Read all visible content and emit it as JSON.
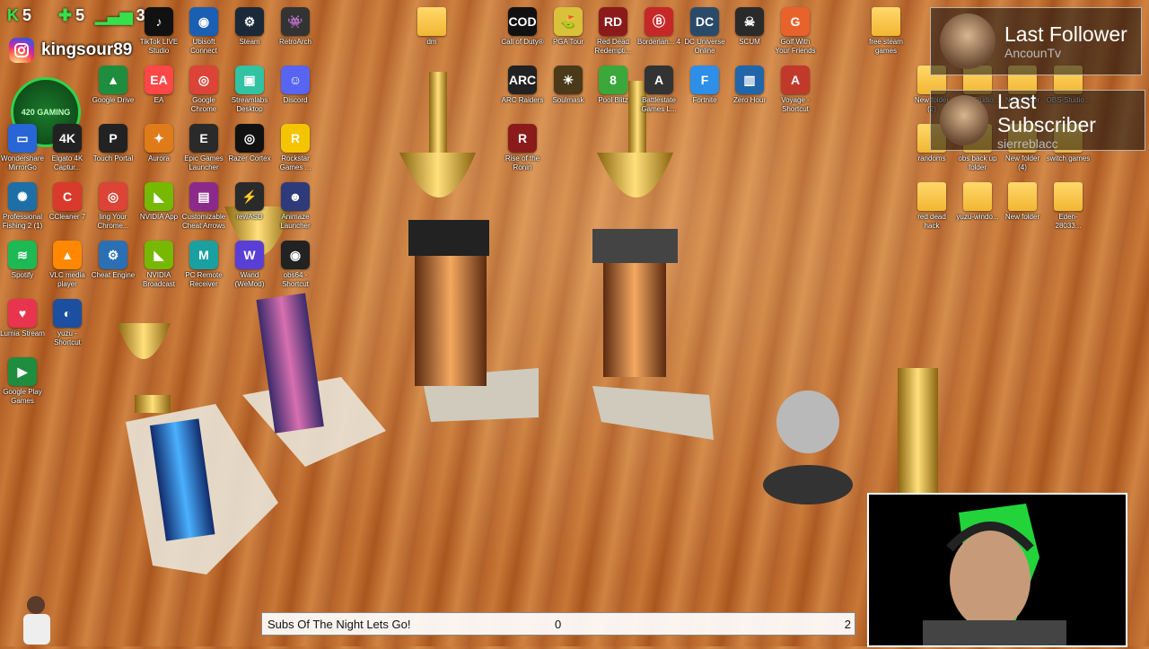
{
  "stats": {
    "kicks": "5",
    "follows": "5",
    "viewers": "3"
  },
  "instagram": {
    "handle": "kingsour89"
  },
  "badge": {
    "text": "420 GAMING"
  },
  "desktop_icons": [
    {
      "label": "TikTok LIVE Studio",
      "icon": "tiktok-icon",
      "color": "#111111",
      "glyph": "♪"
    },
    {
      "label": "Ubisoft Connect",
      "icon": "ubisoft-icon",
      "color": "#1a5fb4",
      "glyph": "◉"
    },
    {
      "label": "Steam",
      "icon": "steam-icon",
      "color": "#1b2838",
      "glyph": "⚙"
    },
    {
      "label": "RetroArch",
      "icon": "retroarch-icon",
      "color": "#333333",
      "glyph": "👾"
    },
    {
      "label": "Google Drive",
      "icon": "google-drive-icon",
      "color": "#1e8e3e",
      "glyph": "▲"
    },
    {
      "label": "EA",
      "icon": "ea-icon",
      "color": "#ff4747",
      "glyph": "EA"
    },
    {
      "label": "Google Chrome",
      "icon": "chrome-icon",
      "color": "#db4437",
      "glyph": "◎"
    },
    {
      "label": "Streamlabs Desktop",
      "icon": "streamlabs-icon",
      "color": "#31c3a2",
      "glyph": "▣"
    },
    {
      "label": "Discord",
      "icon": "discord-icon",
      "color": "#5865f2",
      "glyph": "☺"
    },
    {
      "label": "Wondershare MirrorGo",
      "icon": "mirrorgo-icon",
      "color": "#2866d8",
      "glyph": "▭"
    },
    {
      "label": "Elgato 4K Captur...",
      "icon": "elgato-icon",
      "color": "#222222",
      "glyph": "4K"
    },
    {
      "label": "Touch Portal",
      "icon": "touch-portal-icon",
      "color": "#222222",
      "glyph": "P"
    },
    {
      "label": "Aurora",
      "icon": "aurora-icon",
      "color": "#e07b1a",
      "glyph": "✦"
    },
    {
      "label": "Epic Games Launcher",
      "icon": "epic-games-icon",
      "color": "#2a2a2a",
      "glyph": "E"
    },
    {
      "label": "Razer Cortex",
      "icon": "razer-icon",
      "color": "#111111",
      "glyph": "◎"
    },
    {
      "label": "Rockstar Games ...",
      "icon": "rockstar-icon",
      "color": "#f5c400",
      "glyph": "R"
    },
    {
      "label": "Professional Fishing 2 (1)",
      "icon": "fishing-icon",
      "color": "#1d6fa5",
      "glyph": "✺"
    },
    {
      "label": "CCleaner 7",
      "icon": "ccleaner-icon",
      "color": "#d83b2b",
      "glyph": "C"
    },
    {
      "label": "ling Your Chrome...",
      "icon": "chrome-icon",
      "color": "#db4437",
      "glyph": "◎"
    },
    {
      "label": "NVIDIA App",
      "icon": "nvidia-icon",
      "color": "#76b900",
      "glyph": "◣"
    },
    {
      "label": "Customizable Cheat Arrows",
      "icon": "winrar-icon",
      "color": "#8b2a8b",
      "glyph": "▤"
    },
    {
      "label": "rewASD",
      "icon": "rewasd-icon",
      "color": "#2a2a2a",
      "glyph": "⚡"
    },
    {
      "label": "Animaze Launcher",
      "icon": "animaze-icon",
      "color": "#2f3a7a",
      "glyph": "☻"
    },
    {
      "label": "Spotify",
      "icon": "spotify-icon",
      "color": "#1db954",
      "glyph": "≋"
    },
    {
      "label": "VLC media player",
      "icon": "vlc-icon",
      "color": "#ff8800",
      "glyph": "▲"
    },
    {
      "label": "Cheat Engine",
      "icon": "cheat-engine-icon",
      "color": "#2b6fb5",
      "glyph": "⚙"
    },
    {
      "label": "NVIDIA Broadcast",
      "icon": "nvidia-broadcast-icon",
      "color": "#76b900",
      "glyph": "◣"
    },
    {
      "label": "PC Remote Receiver",
      "icon": "pc-remote-icon",
      "color": "#1aa0a0",
      "glyph": "M"
    },
    {
      "label": "Wand (WeMod)",
      "icon": "wand-icon",
      "color": "#5a3fd6",
      "glyph": "W"
    },
    {
      "label": "obs64 - Shortcut",
      "icon": "obs-icon",
      "color": "#222222",
      "glyph": "◉"
    },
    {
      "label": "Lumia Stream",
      "icon": "lumia-icon",
      "color": "#e8344e",
      "glyph": "♥"
    },
    {
      "label": "yuzu - Shortcut",
      "icon": "yuzu-icon",
      "color": "#1d4fa0",
      "glyph": "◐"
    },
    {
      "label": "Google Play Games",
      "icon": "play-games-icon",
      "color": "#1e8e3e",
      "glyph": "▶"
    },
    {
      "label": "dm",
      "icon": "folder-icon",
      "color": "#f2b632",
      "glyph": ""
    },
    {
      "label": "Call of Duty®",
      "icon": "cod-icon",
      "color": "#111111",
      "glyph": "COD"
    },
    {
      "label": "PGA Tour",
      "icon": "pga-icon",
      "color": "#d9c23a",
      "glyph": "⛳"
    },
    {
      "label": "Red Dead Redempti...",
      "icon": "rdr-icon",
      "color": "#8b1a1a",
      "glyph": "RD"
    },
    {
      "label": "Borderlan... 4",
      "icon": "borderlands-icon",
      "color": "#c62828",
      "glyph": "Ⓑ"
    },
    {
      "label": "DC Universe Online",
      "icon": "dcuo-icon",
      "color": "#2a4a6a",
      "glyph": "DC"
    },
    {
      "label": "SCUM",
      "icon": "scum-icon",
      "color": "#2a2a2a",
      "glyph": "☠"
    },
    {
      "label": "Golf With Your Friends",
      "icon": "golf-icon",
      "color": "#e8622b",
      "glyph": "G"
    },
    {
      "label": "ARC Raiders",
      "icon": "arc-raiders-icon",
      "color": "#222222",
      "glyph": "ARC"
    },
    {
      "label": "Soulmask",
      "icon": "soulmask-icon",
      "color": "#4a3a1a",
      "glyph": "☀"
    },
    {
      "label": "Pool Blitz",
      "icon": "pool-blitz-icon",
      "color": "#3aa83a",
      "glyph": "8"
    },
    {
      "label": "Battlestate Games L...",
      "icon": "battlestate-icon",
      "color": "#333333",
      "glyph": "A"
    },
    {
      "label": "Fortnite",
      "icon": "fortnite-icon",
      "color": "#2d8fe8",
      "glyph": "F"
    },
    {
      "label": "Zero Hour",
      "icon": "zero-hour-icon",
      "color": "#2266aa",
      "glyph": "▥"
    },
    {
      "label": "Voyage - Shortcut",
      "icon": "voyage-icon",
      "color": "#c0392b",
      "glyph": "A"
    },
    {
      "label": "Rise of the Ronin",
      "icon": "ronin-icon",
      "color": "#8b1a1a",
      "glyph": "R"
    },
    {
      "label": "free steam games",
      "icon": "folder-icon",
      "color": "#f2b632",
      "glyph": ""
    },
    {
      "label": "New folder (2)",
      "icon": "folder-icon",
      "color": "#f2b632",
      "glyph": ""
    },
    {
      "label": "OBS-Studio...",
      "icon": "folder-icon",
      "color": "#f2b632",
      "glyph": ""
    },
    {
      "label": "New folder",
      "icon": "folder-icon",
      "color": "#f2b632",
      "glyph": ""
    },
    {
      "label": "OBS-Studio...",
      "icon": "folder-icon",
      "color": "#f2b632",
      "glyph": ""
    },
    {
      "label": "randoms",
      "icon": "folder-icon",
      "color": "#f2b632",
      "glyph": ""
    },
    {
      "label": "obs back up folder",
      "icon": "folder-icon",
      "color": "#f2b632",
      "glyph": ""
    },
    {
      "label": "New folder (4)",
      "icon": "folder-icon",
      "color": "#f2b632",
      "glyph": ""
    },
    {
      "label": "switch games",
      "icon": "folder-icon",
      "color": "#f2b632",
      "glyph": ""
    },
    {
      "label": "red dead hack",
      "icon": "folder-icon",
      "color": "#f2b632",
      "glyph": ""
    },
    {
      "label": "yuzu-windo...",
      "icon": "folder-icon",
      "color": "#f2b632",
      "glyph": ""
    },
    {
      "label": "New folder",
      "icon": "folder-icon",
      "color": "#f2b632",
      "glyph": ""
    },
    {
      "label": "Eden-28033...",
      "icon": "folder-icon",
      "color": "#f2b632",
      "glyph": ""
    }
  ],
  "alerts": {
    "follower": {
      "title": "Last Follower",
      "name": "AncounTv"
    },
    "subscriber": {
      "title": "Last Subscriber",
      "name": "sierreblacc"
    }
  },
  "goal": {
    "label": "Subs Of The Night Lets Go!",
    "current": "0",
    "target": "2"
  }
}
